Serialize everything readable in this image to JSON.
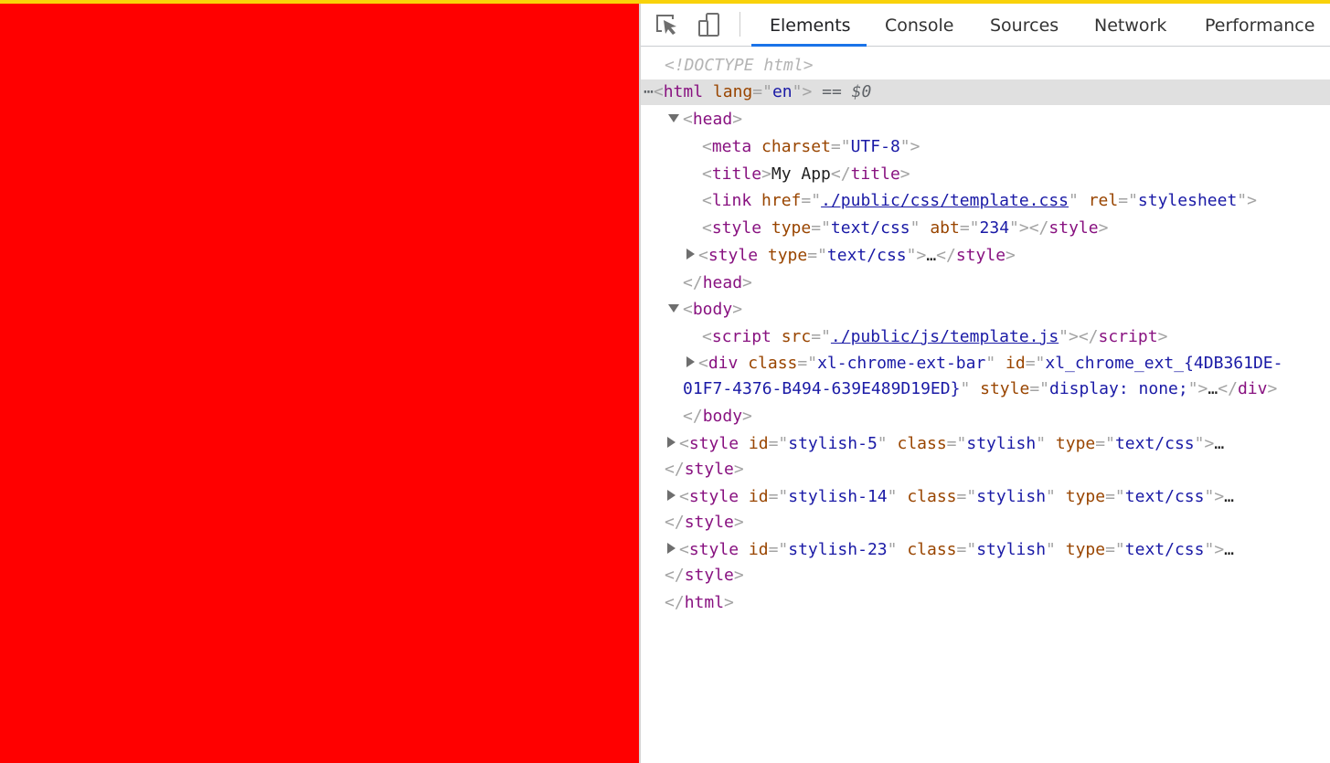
{
  "devtools": {
    "tabs": [
      "Elements",
      "Console",
      "Sources",
      "Network",
      "Performance"
    ],
    "active_tab": "Elements",
    "icons": [
      "inspect-element-icon",
      "device-toolbar-icon"
    ]
  },
  "page_viewport": {
    "background": "#ff0000"
  },
  "dom": {
    "doctype": "<!DOCTYPE html>",
    "html_lang": "en",
    "selected_suffix": "== $0",
    "meta_charset": "UTF-8",
    "title_text": "My App",
    "link_href": "./public/css/template.css",
    "link_rel": "stylesheet",
    "style1_type": "text/css",
    "style1_abt": "234",
    "style2_type": "text/css",
    "script_src": "./public/js/template.js",
    "div_class": "xl-chrome-ext-bar",
    "div_id_part1": "xl_chrome_ext_{4DB361DE-",
    "div_id_part2": "01F7-4376-B494-639E489D19ED}",
    "div_style": "display: none;",
    "stylish": [
      {
        "id": "stylish-5",
        "class": "stylish",
        "type": "text/css"
      },
      {
        "id": "stylish-14",
        "class": "stylish",
        "type": "text/css"
      },
      {
        "id": "stylish-23",
        "class": "stylish",
        "type": "text/css"
      }
    ]
  }
}
